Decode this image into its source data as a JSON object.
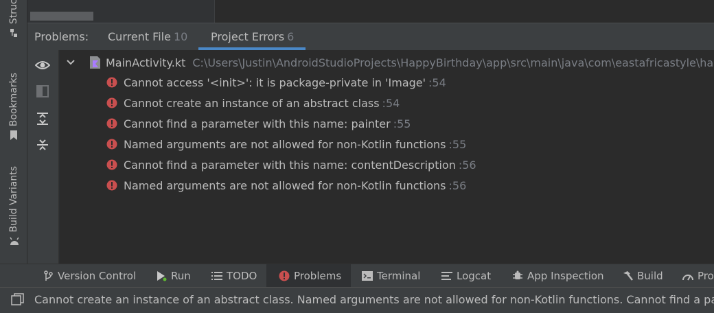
{
  "left_strip": {
    "structure_label": "Structure",
    "bookmarks_label": "Bookmarks",
    "build_variants_label": "Build Variants"
  },
  "problems": {
    "header_label": "Problems:",
    "tabs": [
      {
        "label": "Current File",
        "count": "10"
      },
      {
        "label": "Project Errors",
        "count": "6",
        "active": true
      }
    ]
  },
  "tree": {
    "file_name": "MainActivity.kt",
    "file_path": "C:\\Users\\Justin\\AndroidStudioProjects\\HappyBirthday\\app\\src\\main\\java\\com\\eastafricastyle\\happybirthday",
    "errors": [
      {
        "text": "Cannot access '<init>': it is package-private in 'Image'",
        "line": ":54"
      },
      {
        "text": "Cannot create an instance of an abstract class",
        "line": ":54"
      },
      {
        "text": "Cannot find a parameter with this name: painter",
        "line": ":55"
      },
      {
        "text": "Named arguments are not allowed for non-Kotlin functions",
        "line": ":55"
      },
      {
        "text": "Cannot find a parameter with this name: contentDescription",
        "line": ":56"
      },
      {
        "text": "Named arguments are not allowed for non-Kotlin functions",
        "line": ":56"
      }
    ]
  },
  "bottom_tabs": [
    {
      "label": "Version Control",
      "icon": "branch-icon"
    },
    {
      "label": "Run",
      "icon": "run-icon"
    },
    {
      "label": "TODO",
      "icon": "list-icon"
    },
    {
      "label": "Problems",
      "icon": "error-icon",
      "active": true
    },
    {
      "label": "Terminal",
      "icon": "terminal-icon"
    },
    {
      "label": "Logcat",
      "icon": "logcat-icon"
    },
    {
      "label": "App Inspection",
      "icon": "inspection-icon"
    },
    {
      "label": "Build",
      "icon": "hammer-icon"
    },
    {
      "label": "Profiler",
      "icon": "profiler-icon"
    }
  ],
  "status": {
    "text": "Cannot create an instance of an abstract class. Named arguments are not allowed for non-Kotlin functions. Cannot find a parameter with this name: painter"
  },
  "colors": {
    "error_red": "#c94f4f",
    "accent_blue": "#4a88c7",
    "panel_bg": "#3c3f41",
    "tree_bg": "#2b2b2b"
  }
}
